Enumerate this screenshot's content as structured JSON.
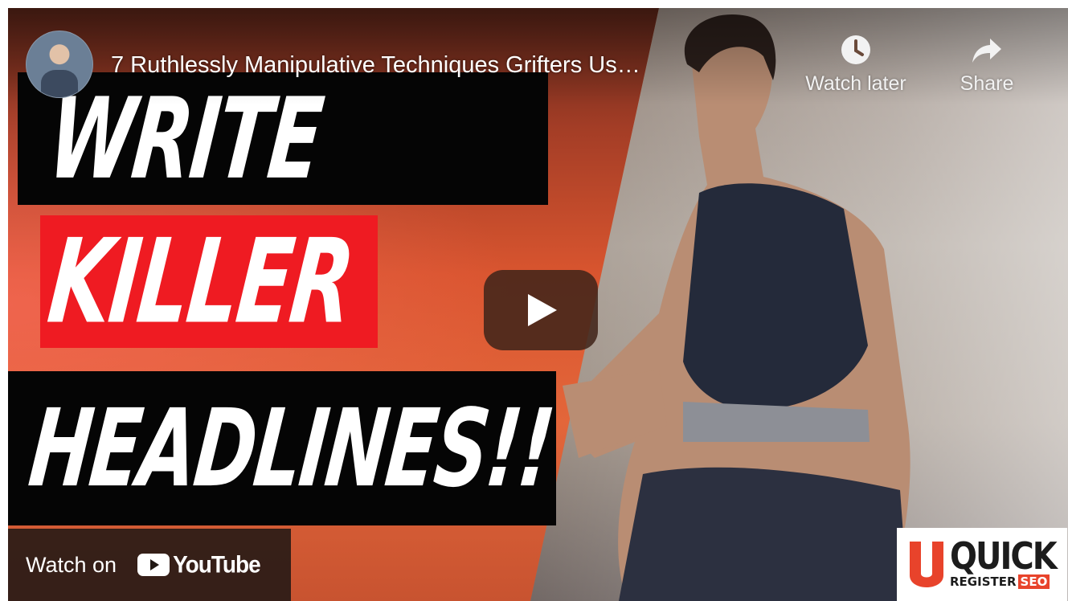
{
  "video": {
    "title": "7 Ruthlessly Manipulative Techniques Grifters Us…",
    "channel_avatar_icon": "channel-avatar"
  },
  "top_actions": {
    "watch_later": {
      "label": "Watch later",
      "icon": "clock-icon"
    },
    "share": {
      "label": "Share",
      "icon": "share-arrow-icon"
    }
  },
  "thumbnail": {
    "line1": "WRITE",
    "line2": "KILLER",
    "line3": "HEADLINES!!",
    "colors": {
      "black_block": "#050505",
      "red_block": "#ef1b22",
      "orange_bg": "#e3663a"
    }
  },
  "player": {
    "play_icon": "play-icon",
    "watch_on_label": "Watch on",
    "youtube_wordmark": "YouTube"
  },
  "brand": {
    "quick": "QUICK",
    "register": "REGISTER",
    "seo": "SEO",
    "accent_color": "#e8432b"
  }
}
